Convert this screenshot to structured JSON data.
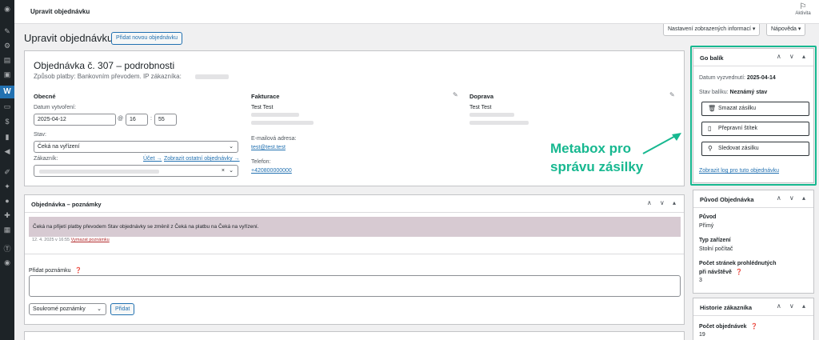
{
  "topbar": {
    "title": "Upravit objednávku",
    "activity_label": "Aktivita"
  },
  "screen_options": {
    "label": "Nastavení zobrazených informací ▾",
    "help": "Nápověda ▾"
  },
  "page": {
    "heading": "Upravit objednávku",
    "add_new": "Přidat novou objednávku"
  },
  "order": {
    "title": "Objednávka č. 307 – podrobnosti",
    "subtitle": "Způsob platby: Bankovním převodem. IP zákazníka:",
    "general": {
      "heading": "Obecné",
      "created_label": "Datum vytvoření:",
      "date": "2025-04-12",
      "at": "@",
      "hour": "16",
      "minute": "55",
      "status_label": "Stav:",
      "status": "Čeká na vyřízení",
      "customer_label": "Zákazník:",
      "profile_link": "Účet →",
      "other_orders_link": "Zobrazit ostatní objednávky →"
    },
    "billing": {
      "heading": "Fakturace",
      "name": "Test Test",
      "email_label": "E-mailová adresa:",
      "email": "test@test.test",
      "phone_label": "Telefon:",
      "phone": "+420800000000"
    },
    "shipping": {
      "heading": "Doprava",
      "name": "Test Test"
    }
  },
  "notes": {
    "heading": "Objednávka – poznámky",
    "note_text": "Čeká na přijetí platby převodem Stav objednávky se změnil z Čeká na platbu na Čeká na vyřízení.",
    "note_meta": "12. 4. 2025 v 16:55",
    "delete_link": "Vymazat poznámku",
    "add_label": "Přidat poznámku",
    "type": "Soukromé poznámky",
    "add_button": "Přidat"
  },
  "gobalik": {
    "heading": "Go balík",
    "pickup_label": "Datum vyzvednutí:",
    "pickup_date": "2025-04-14",
    "status_label": "Stav balíku:",
    "status": "Neznámý stav",
    "delete_button": "Smazat zásilku",
    "label_button": "Přepravní štítek",
    "track_button": "Sledovat zásilku",
    "log_link": "Zobrazit log pro tuto objednávku"
  },
  "annotation": {
    "line1": "Metabox pro",
    "line2": "správu zásilky",
    "color": "#17b890"
  },
  "origin": {
    "heading": "Původ Objednávka",
    "origin_label": "Původ",
    "origin_value": "Přímý",
    "device_label": "Typ zařízení",
    "device_value": "Stolní počítač",
    "pages_label_1": "Počet stránek prohlédnutých",
    "pages_label_2": "při návštěvě",
    "pages_value": "3"
  },
  "history": {
    "heading": "Historie zákazníka",
    "orders_label": "Počet objednávek",
    "orders_value": "19"
  },
  "box_controls": "∧ ∨ ▴"
}
